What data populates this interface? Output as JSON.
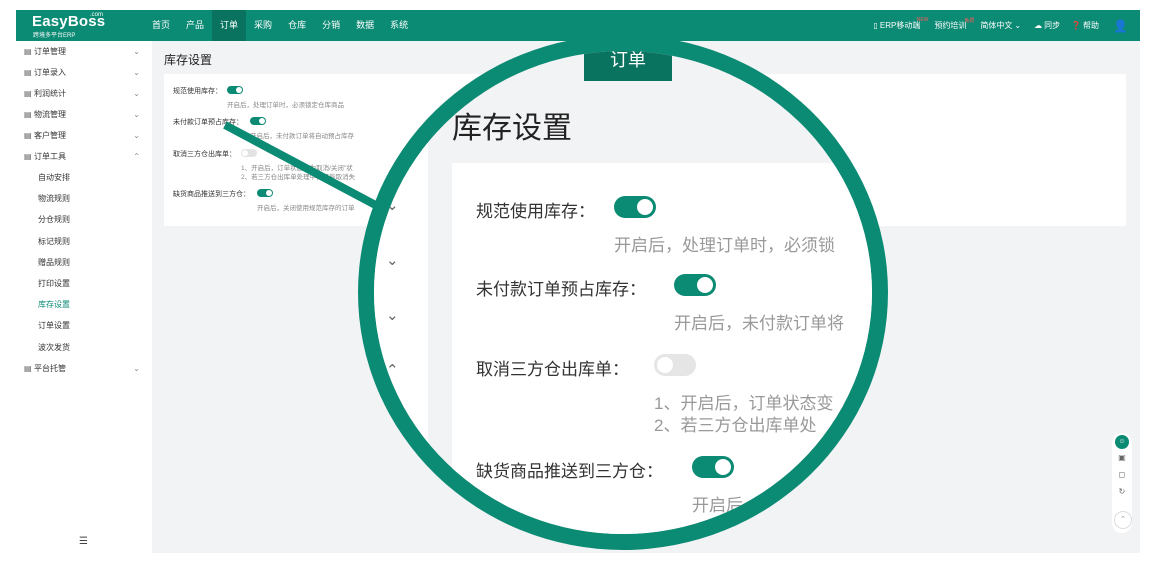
{
  "brand": {
    "name": "EasyBoss",
    "suffix": ".com",
    "tagline": "跨境多平台ERP"
  },
  "topnav": {
    "items": [
      {
        "label": "首页",
        "active": false
      },
      {
        "label": "产品",
        "active": false
      },
      {
        "label": "订单",
        "active": true
      },
      {
        "label": "采购",
        "active": false
      },
      {
        "label": "仓库",
        "active": false
      },
      {
        "label": "分销",
        "active": false
      },
      {
        "label": "数据",
        "active": false
      },
      {
        "label": "系统",
        "active": false
      }
    ],
    "tools": {
      "mobile": "ERP移动端",
      "mobile_badge": "NEW",
      "training": "预约培训",
      "training_badge": "免费",
      "language": "简体中文",
      "sync": "同步",
      "help": "帮助"
    }
  },
  "sidebar": {
    "groups": [
      {
        "label": "订单管理",
        "icon": "clipboard-icon"
      },
      {
        "label": "订单录入",
        "icon": "edit-icon"
      },
      {
        "label": "利润统计",
        "icon": "coin-icon"
      },
      {
        "label": "物流管理",
        "icon": "truck-icon"
      },
      {
        "label": "客户管理",
        "icon": "contact-icon"
      },
      {
        "label": "订单工具",
        "icon": "tools-icon",
        "expanded": true
      }
    ],
    "tools_children": [
      {
        "label": "自动安排"
      },
      {
        "label": "物流规则"
      },
      {
        "label": "分仓规则"
      },
      {
        "label": "标记规则"
      },
      {
        "label": "赠品规则"
      },
      {
        "label": "打印设置"
      },
      {
        "label": "库存设置",
        "active": true
      },
      {
        "label": "订单设置"
      },
      {
        "label": "波次发货"
      }
    ],
    "last_group": {
      "label": "平台托管",
      "icon": "platform-icon"
    }
  },
  "page": {
    "title": "库存设置",
    "settings": [
      {
        "label": "规范使用库存：",
        "enabled": true,
        "desc": "开启后，处理订单时，必须锁定仓库商品"
      },
      {
        "label": "未付款订单预占库存：",
        "enabled": true,
        "desc": "开启后，未付款订单将自动预占库存"
      },
      {
        "label": "取消三方仓出库单：",
        "enabled": false,
        "desc1": "1、开启后，订单状态变为取消/关闭\"状",
        "desc2": "2、若三方仓出库单处理中，可能取消失"
      },
      {
        "label": "缺货商品推送到三方仓：",
        "enabled": true,
        "desc": "开启后，关闭使用规范库存的订单"
      }
    ]
  },
  "magnifier": {
    "tab_label": "订单",
    "title": "库存设置",
    "settings": [
      {
        "label": "规范使用库存：",
        "desc": "开启后，处理订单时，必须锁"
      },
      {
        "label": "未付款订单预占库存：",
        "desc": "开启后，未付款订单将"
      },
      {
        "label": "取消三方仓出库单：",
        "desc1": "1、开启后，订单状态变",
        "desc2": "2、若三方仓出库单处"
      },
      {
        "label": "缺货商品推送到三方仓：",
        "desc": "开启后"
      }
    ]
  },
  "colors": {
    "brand": "#0b8a74",
    "brand_dark": "#0a735f",
    "bg": "#f2f3f5"
  }
}
